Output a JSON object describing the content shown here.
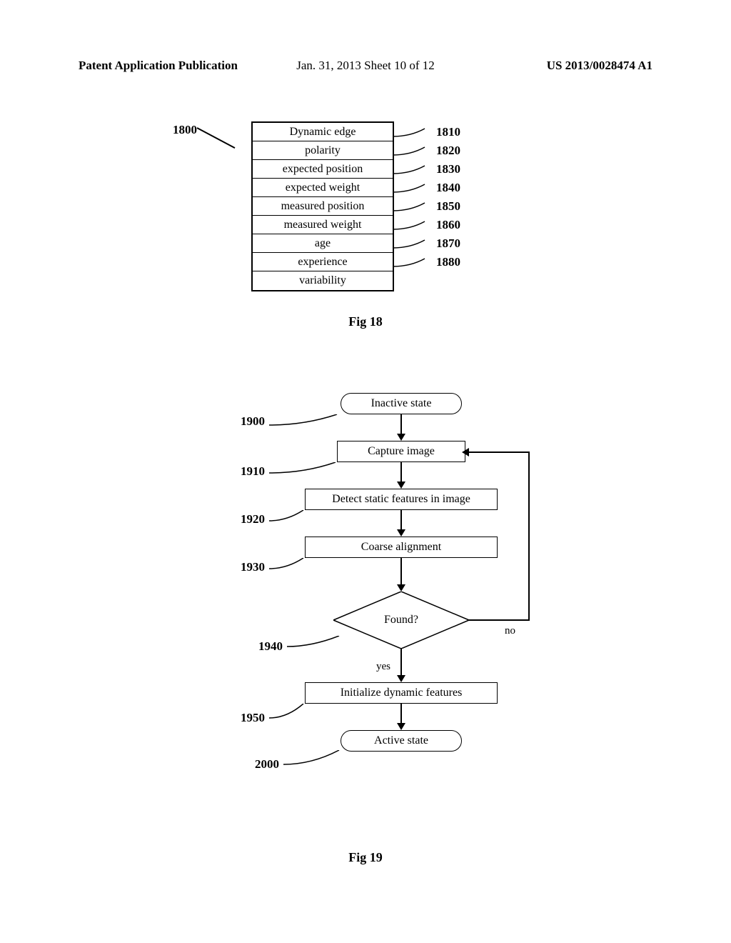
{
  "header": {
    "left": "Patent Application Publication",
    "middle": "Jan. 31, 2013  Sheet 10 of 12",
    "right": "US 2013/0028474 A1"
  },
  "fig18": {
    "mainLabel": "1800",
    "rows": [
      {
        "text": "Dynamic edge",
        "ref": "1810"
      },
      {
        "text": "polarity",
        "ref": "1820"
      },
      {
        "text": "expected position",
        "ref": "1830"
      },
      {
        "text": "expected weight",
        "ref": "1840"
      },
      {
        "text": "measured position",
        "ref": "1850"
      },
      {
        "text": "measured weight",
        "ref": "1860"
      },
      {
        "text": "age",
        "ref": "1870"
      },
      {
        "text": "experience",
        "ref": "1880"
      },
      {
        "text": "variability",
        "ref": ""
      }
    ],
    "caption": "Fig 18"
  },
  "fig19": {
    "nodes": {
      "inactive": {
        "text": "Inactive state",
        "ref": "1900"
      },
      "capture": {
        "text": "Capture image",
        "ref": "1910"
      },
      "detect": {
        "text": "Detect static features in image",
        "ref": "1920"
      },
      "coarse": {
        "text": "Coarse alignment",
        "ref": "1930"
      },
      "found": {
        "text": "Found?",
        "ref": "1940"
      },
      "init": {
        "text": "Initialize dynamic features",
        "ref": "1950"
      },
      "active": {
        "text": "Active state",
        "ref": "2000"
      }
    },
    "edges": {
      "yes": "yes",
      "no": "no"
    },
    "caption": "Fig 19"
  }
}
